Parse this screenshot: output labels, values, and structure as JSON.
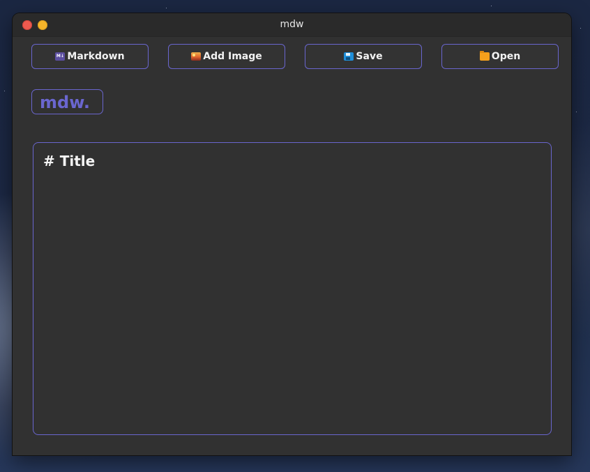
{
  "window": {
    "title": "mdw"
  },
  "toolbar": {
    "buttons": [
      {
        "label": "Markdown",
        "icon": "markdown-icon"
      },
      {
        "label": "Add Image",
        "icon": "image-icon"
      },
      {
        "label": "Save",
        "icon": "floppy-disk-icon"
      },
      {
        "label": "Open",
        "icon": "folder-icon"
      }
    ]
  },
  "logo": {
    "text": "mdw."
  },
  "editor": {
    "content": "# Title"
  },
  "colors": {
    "accent": "#6a66cf",
    "window_bg": "#313131",
    "close": "#ed5a4f",
    "minimize": "#f5b42a"
  }
}
